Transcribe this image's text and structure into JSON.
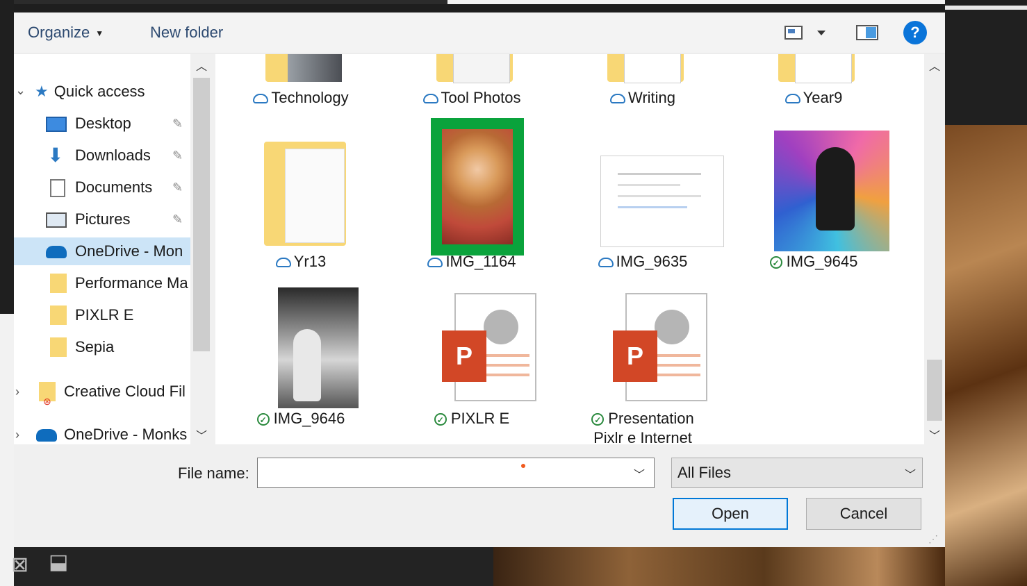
{
  "toolbar": {
    "organize_label": "Organize",
    "new_folder_label": "New folder",
    "help_label": "?"
  },
  "nav": {
    "quick_access": "Quick access",
    "items": [
      {
        "label": "Desktop",
        "icon": "desktop-icon",
        "pinned": true
      },
      {
        "label": "Downloads",
        "icon": "download-arrow-icon",
        "pinned": true
      },
      {
        "label": "Documents",
        "icon": "documents-icon",
        "pinned": true
      },
      {
        "label": "Pictures",
        "icon": "pictures-icon",
        "pinned": true
      },
      {
        "label": "OneDrive - Mon",
        "icon": "onedrive-cloud-icon",
        "selected": true
      },
      {
        "label": "Performance Ma",
        "icon": "folder-icon"
      },
      {
        "label": "PIXLR E",
        "icon": "folder-icon"
      },
      {
        "label": "Sepia",
        "icon": "folder-icon"
      }
    ],
    "creative_cloud": "Creative Cloud Fil",
    "onedrive_monks": "OneDrive - Monks"
  },
  "files": [
    {
      "name": "Technology",
      "status": "cloud"
    },
    {
      "name": "Tool Photos",
      "status": "cloud"
    },
    {
      "name": "Writing",
      "status": "cloud"
    },
    {
      "name": "Year9",
      "status": "cloud"
    },
    {
      "name": "Yr13",
      "status": "cloud"
    },
    {
      "name": "IMG_1164",
      "status": "cloud",
      "highlighted": true
    },
    {
      "name": "IMG_9635",
      "status": "cloud"
    },
    {
      "name": "IMG_9645",
      "status": "synced"
    },
    {
      "name": "IMG_9646",
      "status": "synced"
    },
    {
      "name": "PIXLR E",
      "status": "synced"
    },
    {
      "name": "Presentation",
      "name2": "Pixlr e Internet",
      "status": "synced"
    }
  ],
  "ppt_letter": "P",
  "bottom": {
    "file_name_label": "File name:",
    "file_name_value": "",
    "file_type_value": "All Files",
    "open_label": "Open",
    "cancel_label": "Cancel"
  },
  "colors": {
    "highlight_border": "#0aa33c",
    "selected_nav": "#cce4f7",
    "accent": "#0078d7"
  }
}
